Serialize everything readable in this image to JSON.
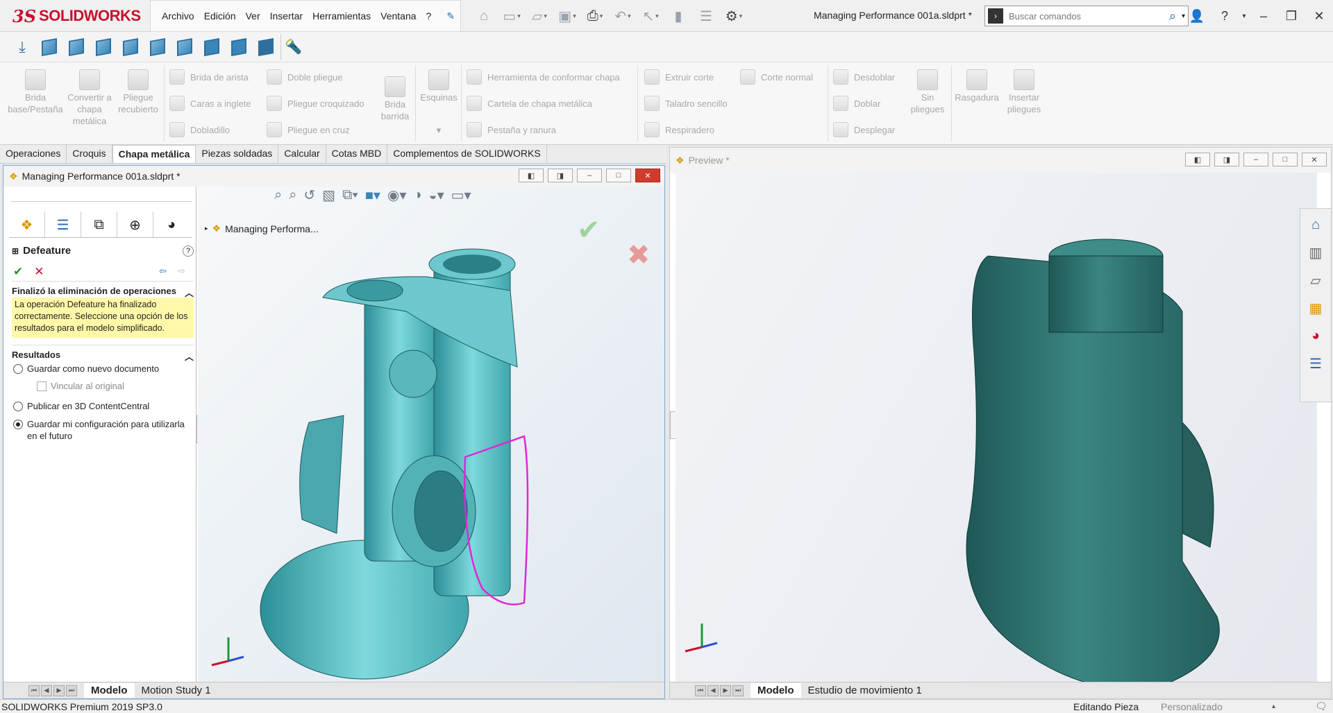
{
  "app": {
    "logo_prefix": "3S",
    "logo": "SOLIDWORKS"
  },
  "menu": [
    "Archivo",
    "Edición",
    "Ver",
    "Insertar",
    "Herramientas",
    "Ventana",
    "?"
  ],
  "document_title": "Managing Performance 001a.sldprt *",
  "search": {
    "placeholder": "Buscar comandos"
  },
  "command_manager": {
    "big_buttons": [
      {
        "label": "Brida base/Pestaña"
      },
      {
        "label": "Convertir a chapa metálica"
      },
      {
        "label": "Pliegue recubierto"
      },
      {
        "label": "Brida barrida"
      },
      {
        "label": "Esquinas"
      },
      {
        "label": "Sin pliegues"
      },
      {
        "label": "Rasgadura"
      },
      {
        "label": "Insertar pliegues"
      }
    ],
    "small_buttons": [
      "Brida de arista",
      "Caras a inglete",
      "Dobladillo",
      "Doble pliegue",
      "Pliegue croquizado",
      "Pliegue en cruz",
      "Herramienta de conformar chapa",
      "Cartela de chapa metálica",
      "Pestaña y ranura",
      "Extruir corte",
      "Taladro sencillo",
      "Respiradero",
      "Corte normal",
      "Desdoblar",
      "Doblar",
      "Desplegar"
    ]
  },
  "tabs": [
    "Operaciones",
    "Croquis",
    "Chapa metálica",
    "Piezas soldadas",
    "Calcular",
    "Cotas MBD",
    "Complementos de SOLIDWORKS"
  ],
  "left_window": {
    "title": "Managing Performance 001a.sldprt *",
    "tree_label": "Managing Performa...",
    "property_manager": {
      "title": "Defeature",
      "section1": "Finalizó la eliminación de operaciones",
      "message": "La operación Defeature ha finalizado correctamente. Seleccione una opción de los resultados para el modelo simplificado.",
      "section2": "Resultados",
      "options": [
        {
          "label": "Guardar como nuevo documento",
          "selected": false
        },
        {
          "label": "Vincular al original",
          "type": "checkbox"
        },
        {
          "label": "Publicar en 3D ContentCentral",
          "selected": false
        },
        {
          "label": "Guardar mi configuración para utilizarla en el futuro",
          "selected": true
        }
      ]
    },
    "bottom_tabs": [
      "Modelo",
      "Motion Study 1"
    ]
  },
  "right_window": {
    "title": "Preview *",
    "bottom_tabs": [
      "Modelo",
      "Estudio de movimiento 1"
    ]
  },
  "status": {
    "left": "SOLIDWORKS Premium 2019 SP3.0",
    "mode": "Editando Pieza",
    "units": "Personalizado"
  },
  "colors": {
    "brand": "#c8102e",
    "model_left": "#5fc4c7",
    "model_right": "#2c6f6d",
    "sketch": "#e026d6",
    "highlight": "#fff8a8"
  }
}
